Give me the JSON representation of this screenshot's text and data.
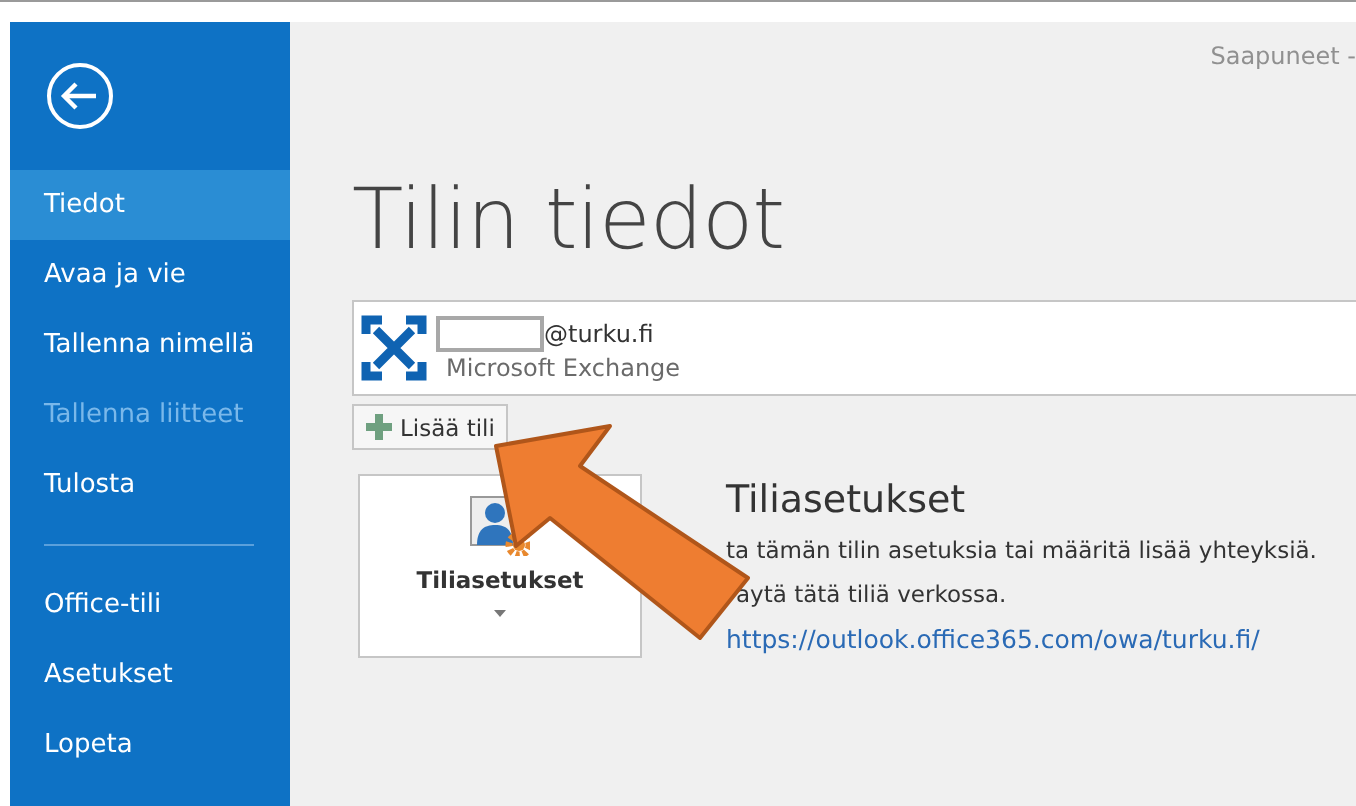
{
  "header": {
    "folder": "Saapuneet -"
  },
  "sidebar": {
    "items": [
      {
        "label": "Tiedot",
        "selected": true,
        "disabled": false,
        "kind": "item"
      },
      {
        "label": "Avaa ja vie",
        "selected": false,
        "disabled": false,
        "kind": "item"
      },
      {
        "label": "Tallenna nimellä",
        "selected": false,
        "disabled": false,
        "kind": "item"
      },
      {
        "label": "Tallenna liitteet",
        "selected": false,
        "disabled": true,
        "kind": "item"
      },
      {
        "label": "Tulosta",
        "selected": false,
        "disabled": false,
        "kind": "item"
      },
      {
        "kind": "divider"
      },
      {
        "label": "Office-tili",
        "selected": false,
        "disabled": false,
        "kind": "item"
      },
      {
        "label": "Asetukset",
        "selected": false,
        "disabled": false,
        "kind": "item"
      },
      {
        "label": "Lopeta",
        "selected": false,
        "disabled": false,
        "kind": "item"
      }
    ]
  },
  "page_title": "Tilin tiedot",
  "account": {
    "email": "@turku.fi",
    "type": "Microsoft Exchange"
  },
  "add_account_button": "Lisää tili",
  "settings": {
    "tile_label": "Tiliasetukset",
    "heading": "Tiliasetukset",
    "lines": [
      "ta tämän tilin asetuksia tai määritä lisää yhteyksiä.",
      "aytä tätä tiliä verkossa."
    ],
    "link": "https://outlook.office365.com/owa/turku.fi/"
  }
}
